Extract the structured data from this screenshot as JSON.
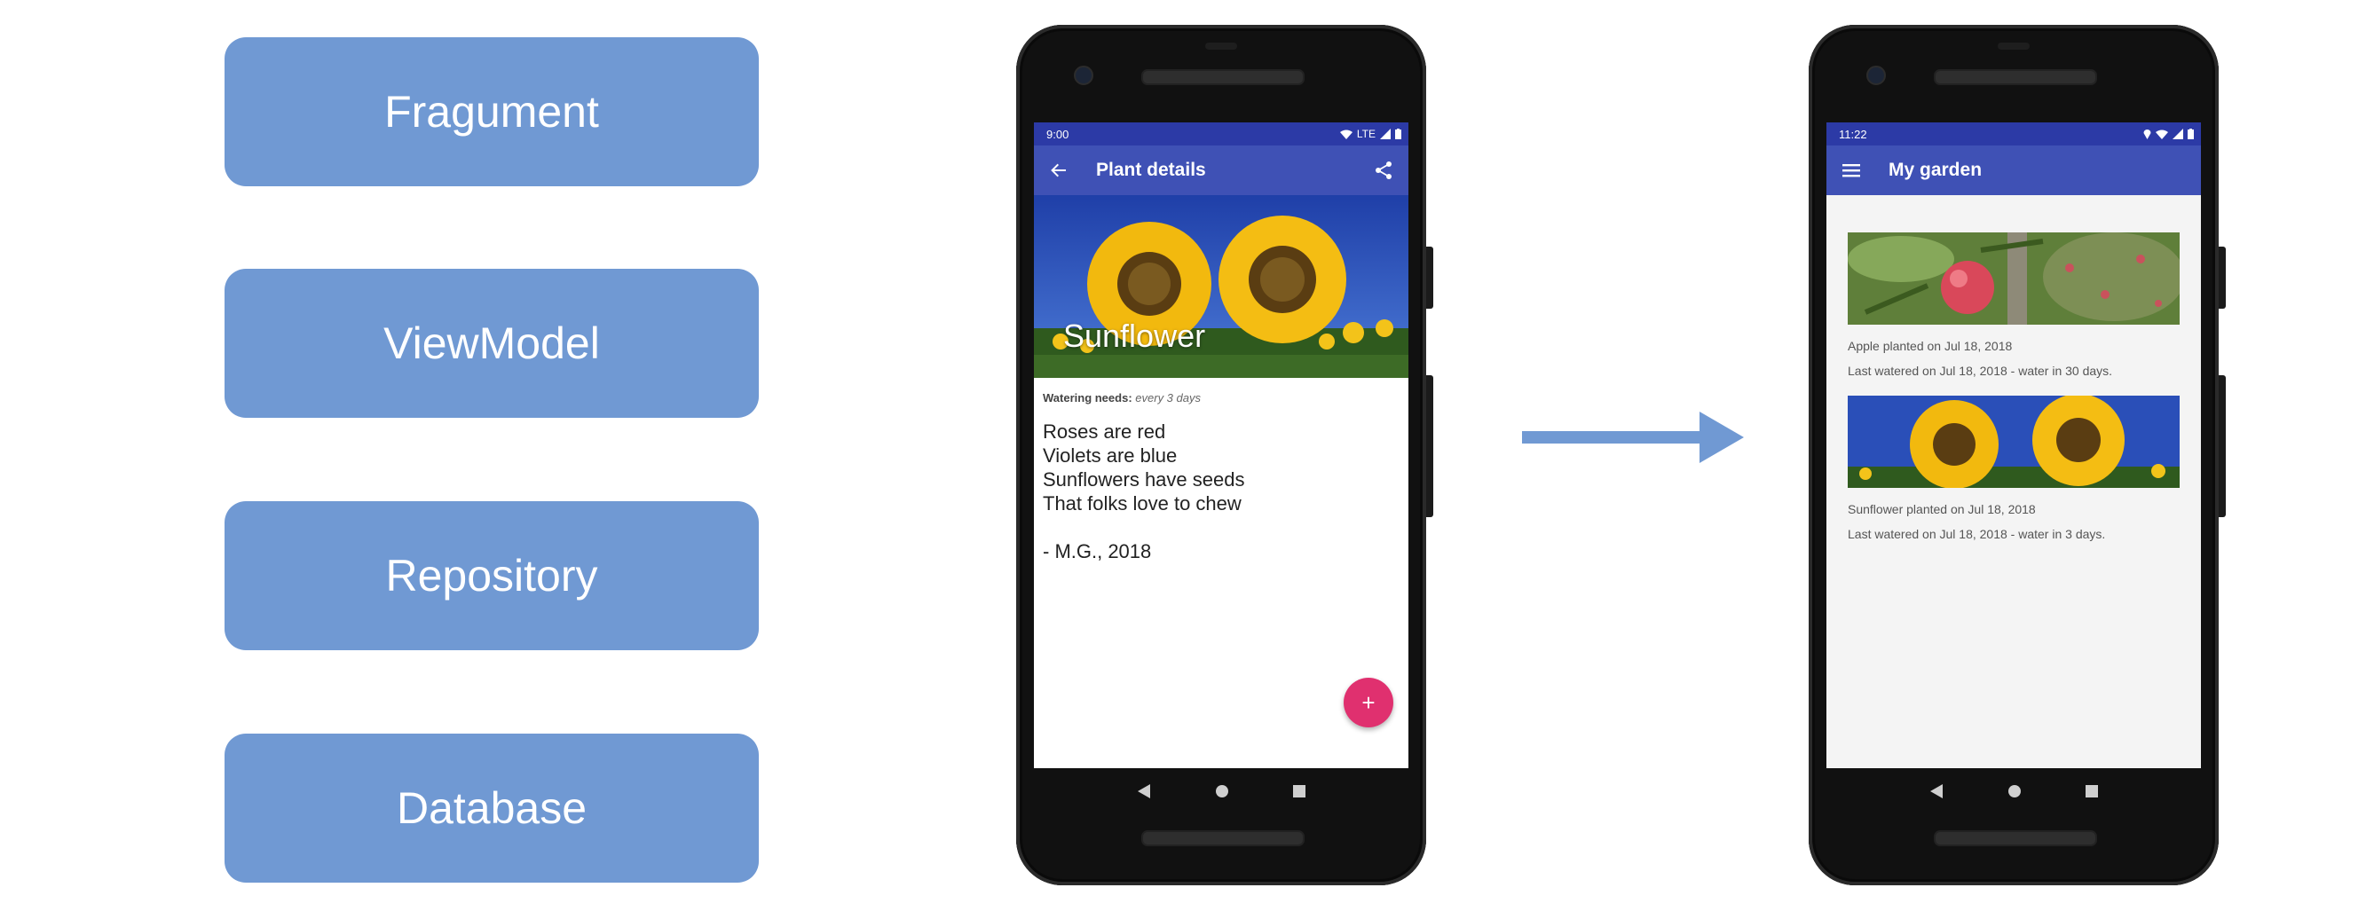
{
  "layers": [
    "Fragument",
    "ViewModel",
    "Repository",
    "Database"
  ],
  "colors": {
    "layer_box": "#7099d3",
    "arrow": "#7099d3",
    "app_bar": "#3f51b5",
    "status_bar": "#2c3aa6",
    "fab": "#e0306f"
  },
  "phone_detail": {
    "status": {
      "time": "9:00",
      "network": "LTE"
    },
    "appbar": {
      "nav_icon": "back-arrow-icon",
      "title": "Plant details",
      "action_icon": "share-icon"
    },
    "hero_title": "Sunflower",
    "watering_label": "Watering needs:",
    "watering_value": "every 3 days",
    "poem": [
      "Roses are red",
      "Violets are blue",
      "Sunflowers have seeds",
      "That folks love to chew",
      "",
      "- M.G., 2018"
    ],
    "fab_label": "+"
  },
  "phone_garden": {
    "status": {
      "time": "11:22"
    },
    "appbar": {
      "nav_icon": "menu-icon",
      "title": "My garden"
    },
    "items": [
      {
        "planted": "Apple planted on Jul 18, 2018",
        "watered": "Last watered on Jul 18, 2018 - water in 30 days."
      },
      {
        "planted": "Sunflower planted on Jul 18, 2018",
        "watered": "Last watered on Jul 18, 2018 - water in 3 days."
      }
    ]
  },
  "system_nav": [
    "back-triangle-icon",
    "home-circle-icon",
    "recents-square-icon"
  ]
}
